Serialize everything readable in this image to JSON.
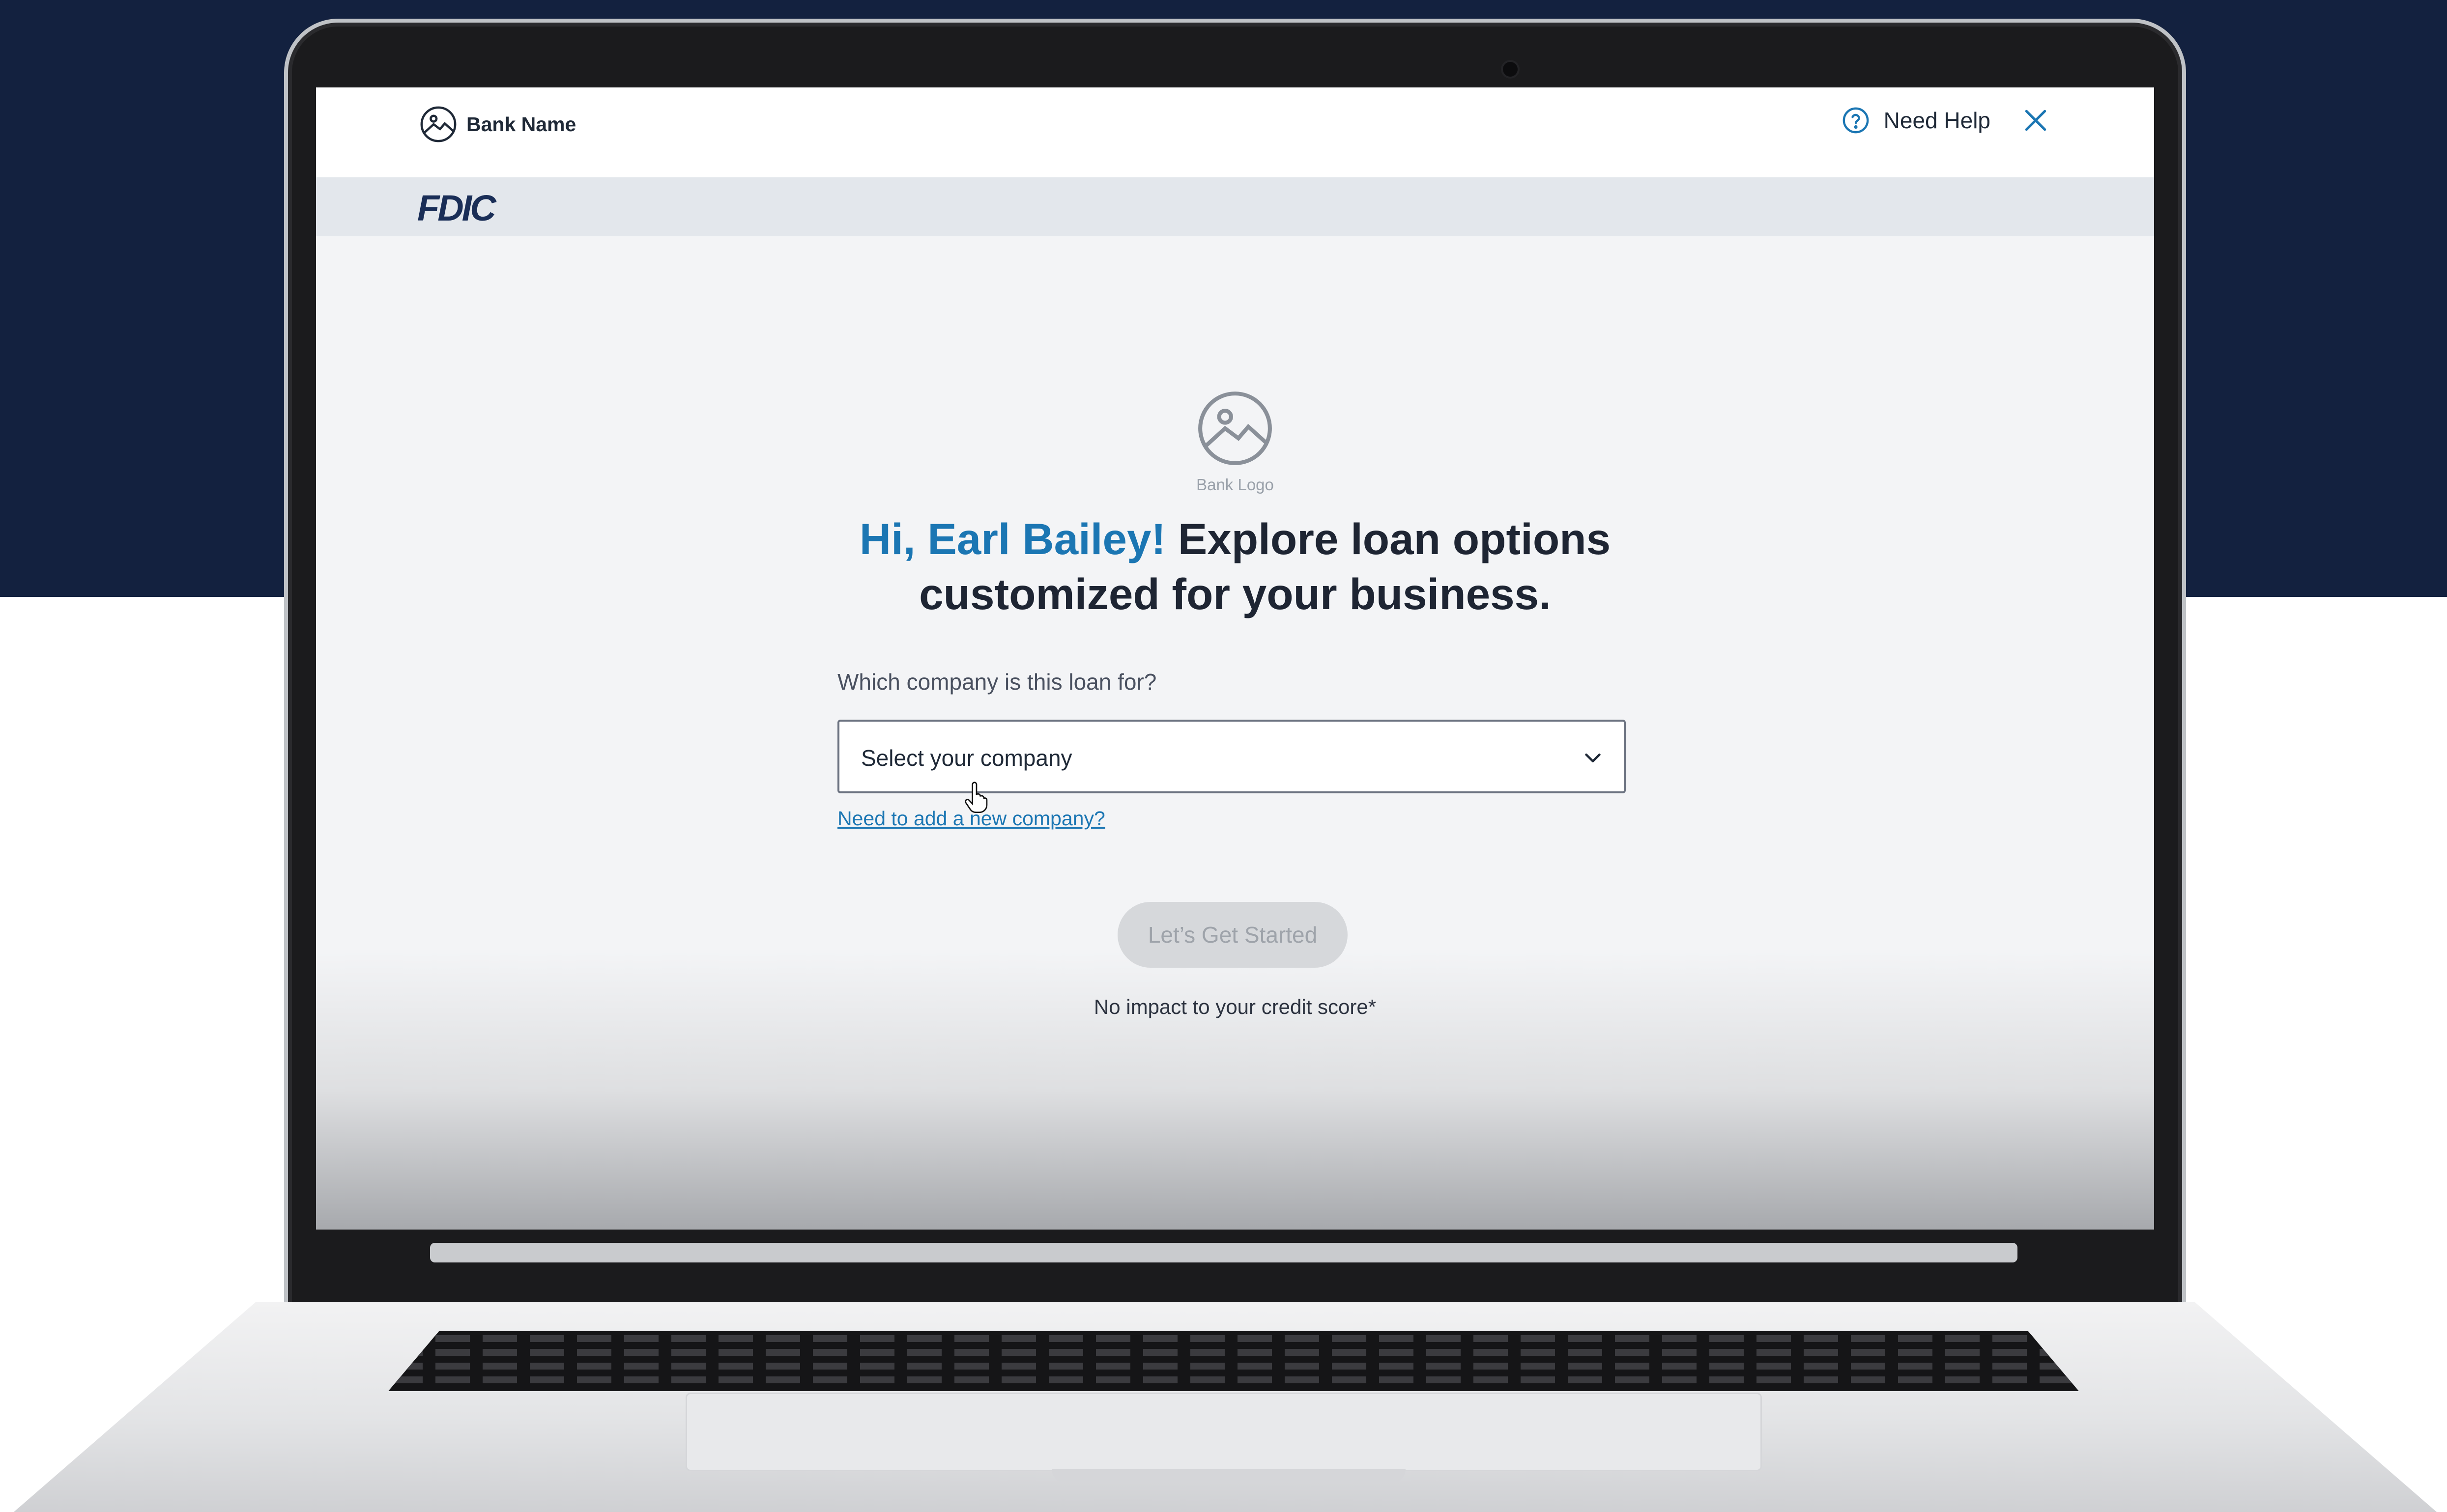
{
  "header": {
    "bank_name": "Bank Name",
    "help_label": "Need Help",
    "partner_logo": "FDIC"
  },
  "main": {
    "logo_caption": "Bank Logo",
    "greeting": "Hi, Earl Bailey!",
    "headline_rest": "Explore loan options customized for your business.",
    "question": "Which company is this loan for?",
    "select_placeholder": "Select your company",
    "add_company_link": "Need to add a new company?",
    "cta_label": "Let’s Get Started",
    "cta_disabled": true,
    "disclaimer": "No impact to your credit score*"
  },
  "icons": {
    "bank": "image-placeholder-icon",
    "help": "question-circle-icon",
    "close": "close-icon",
    "logo": "image-placeholder-icon",
    "dropdown": "chevron-down-icon",
    "cursor": "hand-pointer-icon"
  },
  "colors": {
    "accent": "#1b76b3",
    "navy_background": "#13213f",
    "button_disabled_bg": "#d6d8db",
    "fdic": "#1a2e57"
  }
}
